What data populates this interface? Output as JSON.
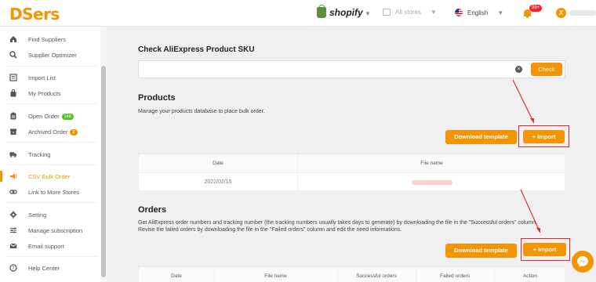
{
  "app": {
    "logo": "DSers"
  },
  "topbar": {
    "platform": "shopify",
    "stores_label": "All stores",
    "language": "English",
    "notification_count": "99+",
    "avatar_initial": "X"
  },
  "sidebar": {
    "items": [
      {
        "label": "Find Suppliers",
        "icon": "home-icon"
      },
      {
        "label": "Supplier Optimizer",
        "icon": "search-icon"
      },
      {
        "label": "Import List",
        "icon": "list-icon"
      },
      {
        "label": "My Products",
        "icon": "bag-icon"
      },
      {
        "label": "Open Order",
        "icon": "clipboard-icon",
        "badge": "148"
      },
      {
        "label": "Archived Order",
        "icon": "archive-icon",
        "badge": "2"
      },
      {
        "label": "Tracking",
        "icon": "truck-icon"
      },
      {
        "label": "CSV Bulk Order",
        "icon": "megaphone-icon",
        "active": true
      },
      {
        "label": "Link to More Stores",
        "icon": "link-icon"
      },
      {
        "label": "Setting",
        "icon": "gear-icon"
      },
      {
        "label": "Manage subscription",
        "icon": "sliders-icon"
      },
      {
        "label": "Email support",
        "icon": "mail-icon"
      },
      {
        "label": "Help Center",
        "icon": "help-icon"
      }
    ]
  },
  "sku": {
    "title": "Check AliExpress Product SKU",
    "input_value": "",
    "check_label": "Check"
  },
  "products": {
    "title": "Products",
    "description": "Manage your products database to place bulk order.",
    "download_label": "Download template",
    "import_label": "Import",
    "columns": [
      "Date",
      "File name"
    ],
    "rows": [
      {
        "date": "2022/02/15"
      }
    ]
  },
  "orders": {
    "title": "Orders",
    "description_line1": "Get AliExpress order numbers and tracking number (the tracking numbers usually takes days to generate) by downloading the file in the \"Successful orders\" column.",
    "description_line2": "Revise the failed orders by downloading the file in the \"Failed orders\" column and edit the need informations.",
    "download_label": "Download template",
    "import_label": "Import",
    "columns": [
      "Date",
      "File name",
      "Successful orders",
      "Failed orders",
      "Action"
    ]
  }
}
